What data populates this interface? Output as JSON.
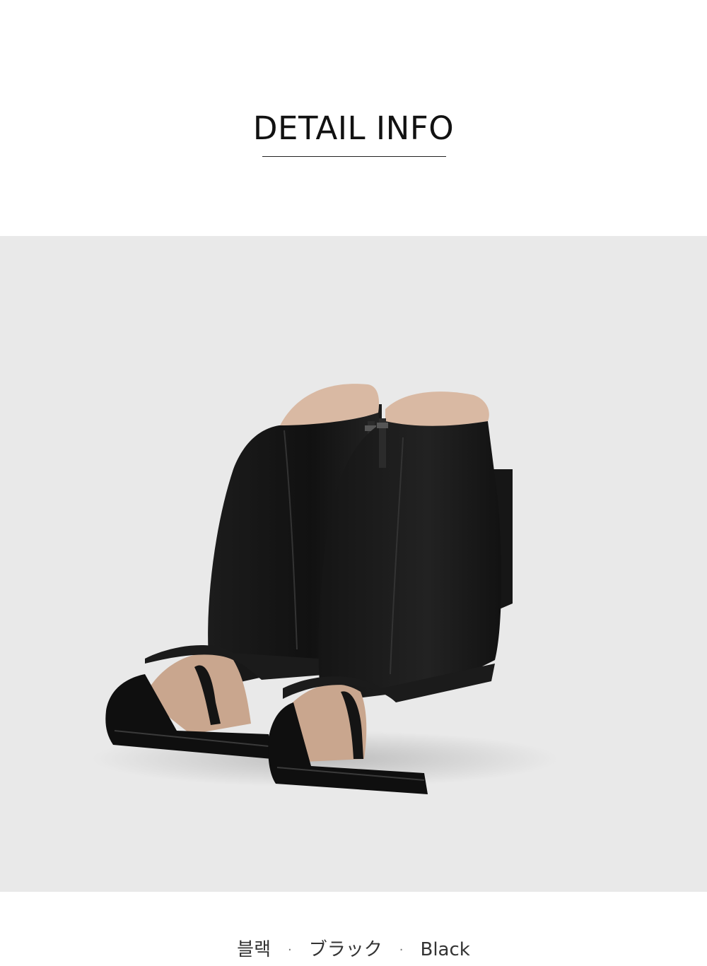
{
  "header": {
    "title": "DETAIL INFO"
  },
  "product_image": {
    "subject": "black-leather-open-toe-ankle-boots",
    "background_color": "#e9e9e9",
    "product_color": "#141414",
    "lining_color": "#d9b9a3"
  },
  "color_names": {
    "korean": "블랙",
    "separator": "·",
    "japanese": "ブラック",
    "english": "Black"
  }
}
